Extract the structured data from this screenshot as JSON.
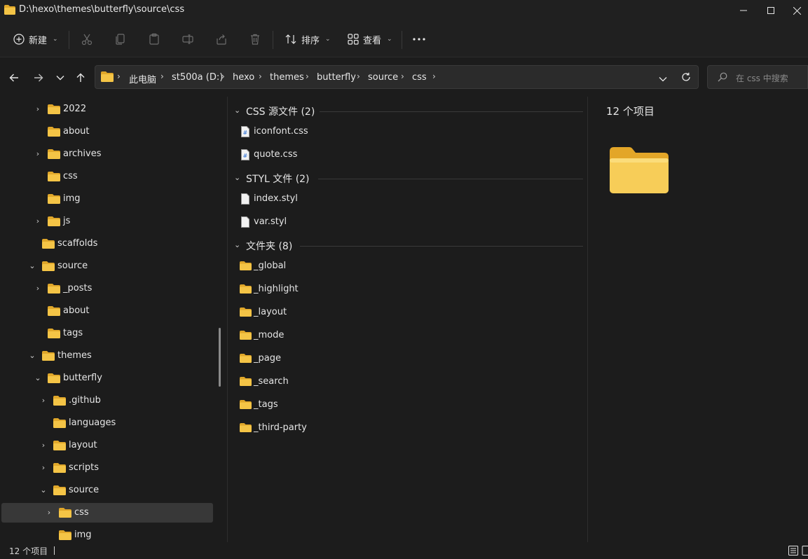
{
  "window": {
    "title": "D:\\hexo\\themes\\butterfly\\source\\css",
    "buttons": [
      "minimize",
      "maximize",
      "close"
    ]
  },
  "toolbar": {
    "new_label": "新建",
    "sort_label": "排序",
    "view_label": "查看",
    "icons": [
      "cut-icon",
      "copy-icon",
      "paste-icon",
      "rename-icon",
      "share-icon",
      "delete-icon",
      "more-icon"
    ]
  },
  "address": {
    "crumbs": [
      "此电脑",
      "st500a (D:)",
      "hexo",
      "themes",
      "butterfly",
      "source",
      "css"
    ]
  },
  "search": {
    "placeholder": "在 css 中搜索"
  },
  "nav": {
    "items": [
      {
        "label": "2022",
        "expand": "collapsed"
      },
      {
        "label": "about",
        "expand": "none"
      },
      {
        "label": "archives",
        "expand": "collapsed"
      },
      {
        "label": "css",
        "expand": "none"
      },
      {
        "label": "img",
        "expand": "none"
      },
      {
        "label": "js",
        "expand": "collapsed"
      },
      {
        "label": "scaffolds",
        "expand": "none"
      },
      {
        "label": "source",
        "expand": "expanded"
      },
      {
        "label": "_posts",
        "expand": "collapsed"
      },
      {
        "label": "about",
        "expand": "none"
      },
      {
        "label": "tags",
        "expand": "none"
      },
      {
        "label": "themes",
        "expand": "expanded"
      },
      {
        "label": "butterfly",
        "expand": "expanded"
      },
      {
        "label": ".github",
        "expand": "collapsed"
      },
      {
        "label": "languages",
        "expand": "none"
      },
      {
        "label": "layout",
        "expand": "collapsed"
      },
      {
        "label": "scripts",
        "expand": "collapsed"
      },
      {
        "label": "source",
        "expand": "expanded"
      },
      {
        "label": "css",
        "expand": "collapsed",
        "selected": true
      },
      {
        "label": "img",
        "expand": "none"
      }
    ]
  },
  "content": {
    "groups": [
      {
        "title": "CSS 源文件 (2)",
        "items": [
          {
            "name": "iconfont.css",
            "type": "css"
          },
          {
            "name": "quote.css",
            "type": "css"
          }
        ]
      },
      {
        "title": "STYL 文件 (2)",
        "items": [
          {
            "name": "index.styl",
            "type": "file"
          },
          {
            "name": "var.styl",
            "type": "file"
          }
        ]
      },
      {
        "title": "文件夹 (8)",
        "items": [
          {
            "name": "_global",
            "type": "folder"
          },
          {
            "name": "_highlight",
            "type": "folder"
          },
          {
            "name": "_layout",
            "type": "folder"
          },
          {
            "name": "_mode",
            "type": "folder"
          },
          {
            "name": "_page",
            "type": "folder"
          },
          {
            "name": "_search",
            "type": "folder"
          },
          {
            "name": "_tags",
            "type": "folder"
          },
          {
            "name": "_third-party",
            "type": "folder"
          }
        ]
      }
    ]
  },
  "details": {
    "count_label": "12 个项目"
  },
  "status": {
    "items_label": "12 个项目"
  },
  "colors": {
    "folder": "#f4c446",
    "folder_dark": "#e0a72a",
    "selected_bg": "#383838",
    "background": "#1c1c1c"
  }
}
